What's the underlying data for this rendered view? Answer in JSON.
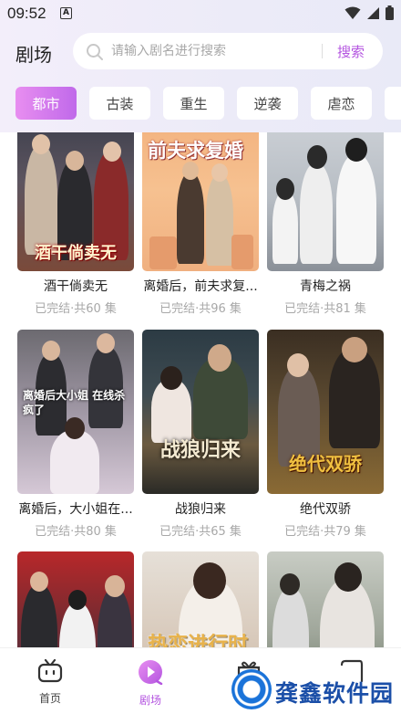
{
  "status_bar": {
    "time": "09:52",
    "notification_icon": "a-icon",
    "icons": [
      "wifi-icon",
      "signal-icon",
      "battery-icon"
    ]
  },
  "header": {
    "title": "剧场",
    "search_placeholder": "请输入剧名进行搜索",
    "search_button": "搜索"
  },
  "tabs": [
    {
      "label": "都市",
      "active": true
    },
    {
      "label": "古装",
      "active": false
    },
    {
      "label": "重生",
      "active": false
    },
    {
      "label": "逆袭",
      "active": false
    },
    {
      "label": "虐恋",
      "active": false
    }
  ],
  "dramas": [
    {
      "name": "酒干倘卖无",
      "meta": "已完结·共60 集",
      "poster_text": "酒干倘卖无"
    },
    {
      "name": "离婚后，前夫求复...",
      "meta": "已完结·共96 集",
      "poster_text": "前夫求复婚"
    },
    {
      "name": "青梅之祸",
      "meta": "已完结·共81 集",
      "poster_text": ""
    },
    {
      "name": "离婚后，大小姐在...",
      "meta": "已完结·共80 集",
      "poster_text": "离婚后大小姐 在线杀疯了"
    },
    {
      "name": "战狼归来",
      "meta": "已完结·共65 集",
      "poster_text": "战狼归来"
    },
    {
      "name": "绝代双骄",
      "meta": "已完结·共79 集",
      "poster_text": "绝代双骄"
    },
    {
      "name": "",
      "meta": "",
      "poster_text": ""
    },
    {
      "name": "",
      "meta": "",
      "poster_text": "热恋进行时"
    },
    {
      "name": "",
      "meta": "",
      "poster_text": ""
    }
  ],
  "bottom_nav": [
    {
      "label": "首页",
      "icon": "tv-icon",
      "active": false
    },
    {
      "label": "剧场",
      "icon": "play-icon",
      "active": true
    },
    {
      "label": "",
      "icon": "gift-icon",
      "active": false
    },
    {
      "label": "",
      "icon": "profile-icon",
      "active": false
    }
  ],
  "watermark": {
    "text": "龚鑫软件园"
  },
  "colors": {
    "accent": "#b455e0",
    "tab_gradient_start": "#e88ef0",
    "tab_gradient_end": "#c069ea",
    "meta_gray": "#a8a8a8"
  }
}
